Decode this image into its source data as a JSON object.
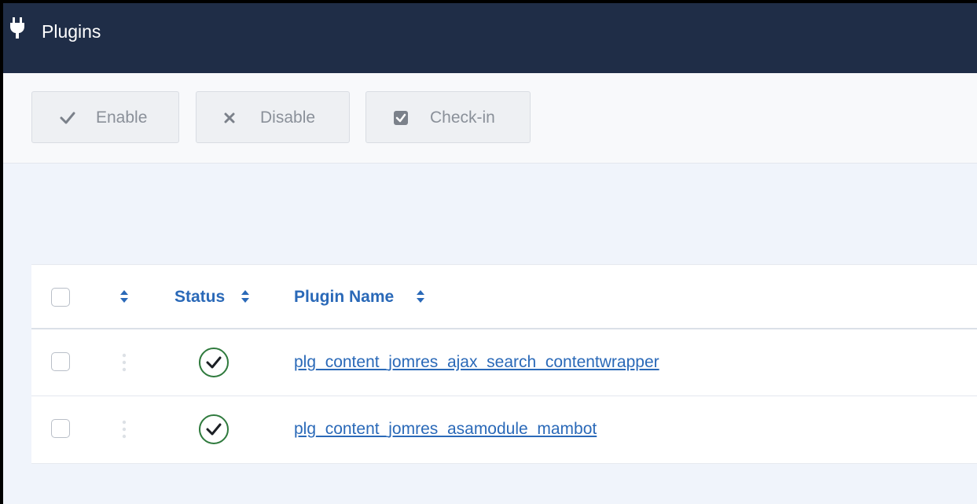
{
  "header": {
    "title": "Plugins",
    "icon": "plug-icon"
  },
  "toolbar": {
    "enable_label": "Enable",
    "disable_label": "Disable",
    "checkin_label": "Check-in"
  },
  "table": {
    "columns": {
      "status": "Status",
      "plugin_name": "Plugin Name"
    },
    "rows": [
      {
        "status": "enabled",
        "name": "plg_content_jomres_ajax_search_contentwrapper"
      },
      {
        "status": "enabled",
        "name": "plg_content_jomres_asamodule_mambot"
      }
    ]
  },
  "colors": {
    "header_bg": "#1f2d47",
    "link": "#2a69b8",
    "status_ok": "#2f7a3d"
  }
}
